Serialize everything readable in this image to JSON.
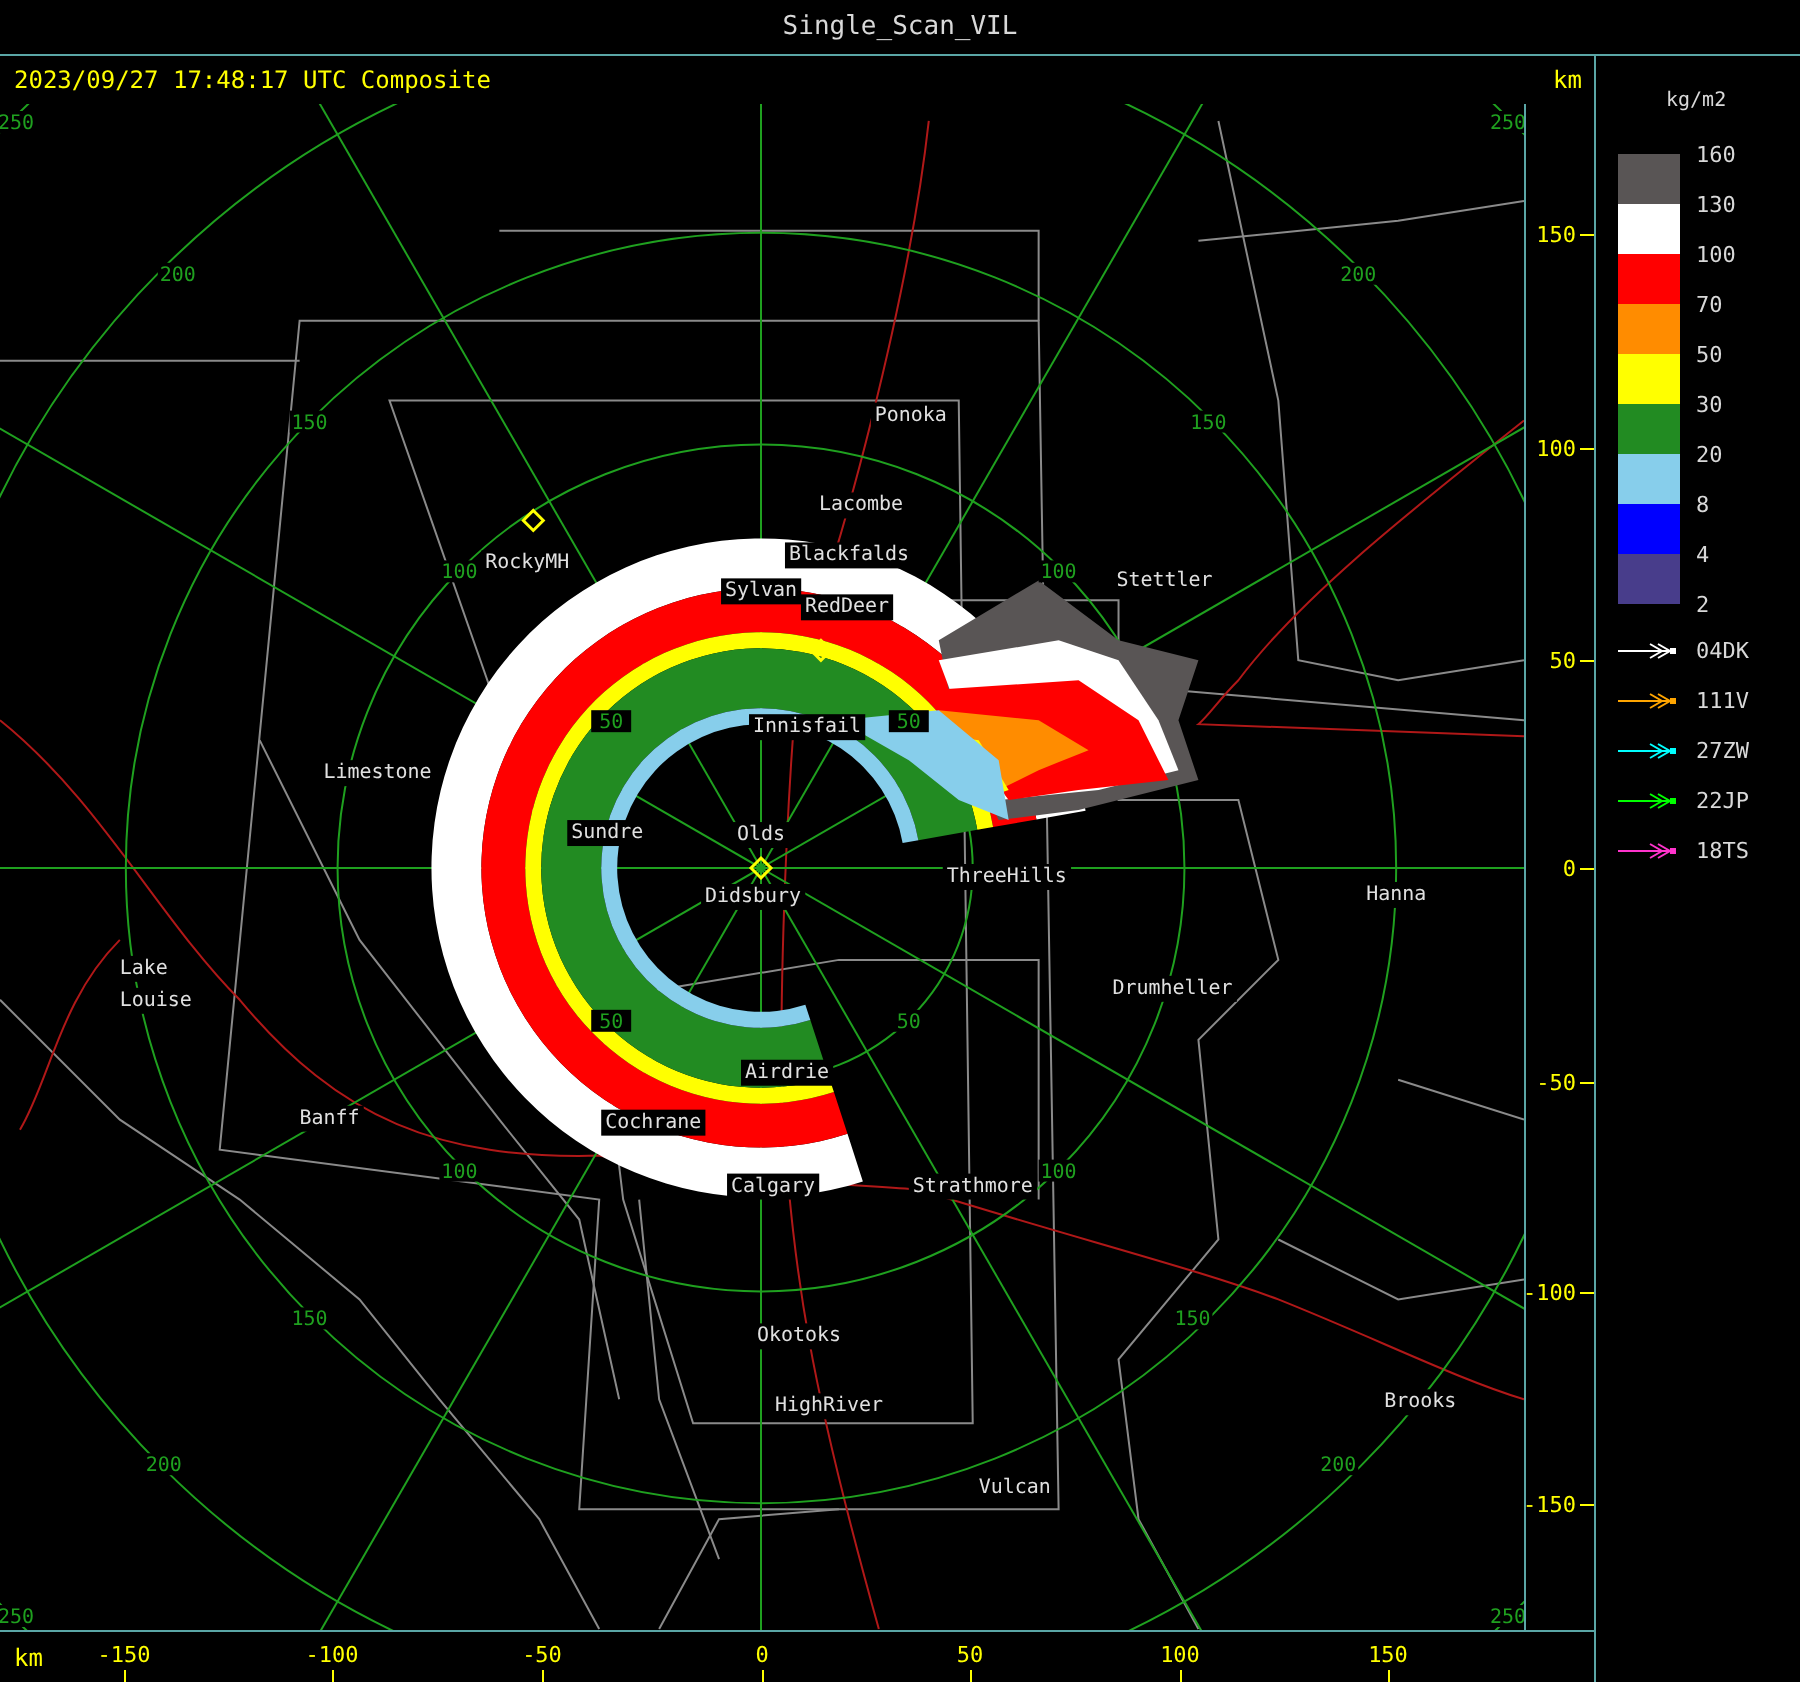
{
  "window": {
    "title": "Single_Scan_VIL"
  },
  "header": {
    "timestamp": "2023/09/27 17:48:17 UTC Composite",
    "unit": "km"
  },
  "map": {
    "places": [
      {
        "text": "Ponoka"
      },
      {
        "text": "Lacombe"
      },
      {
        "text": "Blackfalds"
      },
      {
        "text": "Sylvan"
      },
      {
        "text": "RedDeer"
      },
      {
        "text": "Innisfail"
      },
      {
        "text": "Stettler"
      },
      {
        "text": "RockyMH"
      },
      {
        "text": "Limestone"
      },
      {
        "text": "Sundre"
      },
      {
        "text": "Olds"
      },
      {
        "text": "Didsbury"
      },
      {
        "text": "ThreeHills"
      },
      {
        "text": "Hanna"
      },
      {
        "text": "Lake"
      },
      {
        "text": "Louise"
      },
      {
        "text": "Drumheller"
      },
      {
        "text": "Airdrie"
      },
      {
        "text": "Banff"
      },
      {
        "text": "Cochrane"
      },
      {
        "text": "Calgary"
      },
      {
        "text": "Strathmore"
      },
      {
        "text": "Okotoks"
      },
      {
        "text": "HighRiver"
      },
      {
        "text": "Vulcan"
      },
      {
        "text": "Brooks"
      }
    ],
    "ring_labels": [
      "250",
      "250",
      "200",
      "200",
      "150",
      "150",
      "100",
      "100",
      "50",
      "50",
      "50",
      "50",
      "100",
      "100",
      "150",
      "150",
      "200",
      "200",
      "250",
      "250"
    ]
  },
  "y_axis": {
    "ticks": [
      "150",
      "100",
      "50",
      "0",
      "-50",
      "-100",
      "-150"
    ]
  },
  "x_axis": {
    "unit": "km",
    "ticks": [
      "-150",
      "-100",
      "-50",
      "0",
      "50",
      "100",
      "150"
    ]
  },
  "legend": {
    "unit": "kg/m2",
    "values": [
      "160",
      "130",
      "100",
      "70",
      "50",
      "30",
      "20",
      "8",
      "4",
      "2"
    ],
    "bands": [
      {
        "color": "#595555"
      },
      {
        "color": "#ffffff"
      },
      {
        "color": "#ff0000"
      },
      {
        "color": "#ff8c00"
      },
      {
        "color": "#ffff00"
      },
      {
        "color": "#228b22"
      },
      {
        "color": "#87ceeb"
      },
      {
        "color": "#0000ff"
      },
      {
        "color": "#483d8b"
      }
    ],
    "tracks": [
      {
        "label": "04DK",
        "color": "#ffffff"
      },
      {
        "label": "111V",
        "color": "#ffa500"
      },
      {
        "label": "27ZW",
        "color": "#00ffff"
      },
      {
        "label": "22JP",
        "color": "#00ff00"
      },
      {
        "label": "18TS",
        "color": "#ff33cc"
      }
    ]
  }
}
